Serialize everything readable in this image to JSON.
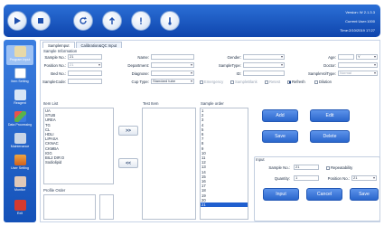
{
  "toolbar": {
    "buttons": [
      {
        "name": "play-icon"
      },
      {
        "name": "stop-icon"
      },
      {
        "name": "refresh-icon"
      },
      {
        "name": "up-arrow-icon"
      },
      {
        "name": "alert-icon"
      },
      {
        "name": "thermometer-icon"
      }
    ],
    "version": "Version: W 2.1.3.3",
    "user": "Current User:1000",
    "time": "Time:2/10/2019 17:27"
  },
  "sidebar": {
    "items": [
      {
        "label": "Program Input",
        "icon": "program-input-icon"
      },
      {
        "label": "Item Setting",
        "icon": "item-setting-icon"
      },
      {
        "label": "Reagent",
        "icon": "reagent-icon"
      },
      {
        "label": "Data Processing",
        "icon": "data-processing-icon"
      },
      {
        "label": "Maintenance",
        "icon": "maintenance-icon"
      },
      {
        "label": "User Setting",
        "icon": "user-setting-icon"
      },
      {
        "label": "Monitor",
        "icon": "monitor-icon"
      },
      {
        "label": "Exit",
        "icon": "exit-icon"
      }
    ]
  },
  "tabs": [
    "SampleInput",
    "Calibration&QC Input"
  ],
  "sample_info": {
    "section": "Sample Information",
    "sample_no_label": "Sample No.:",
    "sample_no_value": "21",
    "position_label": "Position No.:",
    "position_value": "21",
    "bed_label": "Bed No.:",
    "sample_code_label": "SampleCode:",
    "name_label": "Name:",
    "department_label": "Department:",
    "diagnose_label": "Diagnose:",
    "cup_type_label": "Cup Type:",
    "cup_type_value": "Standard tube",
    "gender_label": "Gender:",
    "sample_type_label": "SampleType:",
    "id_label": "ID:",
    "age_label": "Age:",
    "age_unit": "Y",
    "doctor_label": "Doctor:",
    "sample_vol_label": "SampleVolType:",
    "sample_vol_value": "Normal",
    "emergency_label": "Emergency",
    "sample_blank_label": "SampleBlank",
    "retest_label": "Retest",
    "refresh_label": "Refresh",
    "dilution_label": "Dilution"
  },
  "item_list": {
    "label": "Item List",
    "items": [
      "UA",
      "STUB",
      "UREA",
      "TG",
      "CL",
      "HDLI",
      "LIPASA",
      "CKNAC",
      "CKMBA",
      "IGG",
      "BIL2 DIR D",
      "Sodiolipid"
    ]
  },
  "test_item": {
    "label": "Test Item"
  },
  "sample_order": {
    "label": "Sample order",
    "rows": [
      "1",
      "2",
      "3",
      "4",
      "5",
      "6",
      "7",
      "8",
      "9",
      "10",
      "11",
      "12",
      "13",
      "14",
      "15",
      "16",
      "17",
      "18",
      "19",
      "20",
      "21"
    ],
    "selected": "21"
  },
  "profile": {
    "label": "Profile Order"
  },
  "buttons": {
    "add": "Add",
    "edit": "Edit",
    "save": "Save",
    "delete": "Delete",
    "move_right": ">>",
    "move_left": "<<"
  },
  "input_panel": {
    "label": "Input",
    "sample_no_label": "Sample No.:",
    "sample_no_value": "21",
    "quantity_label": "Quantity:",
    "quantity_value": "1",
    "repeatability_label": "Repeatability",
    "position_label": "Position No.:",
    "position_value": "21",
    "input_btn": "Input",
    "cancel_btn": "Cancel",
    "save_btn": "Save"
  }
}
